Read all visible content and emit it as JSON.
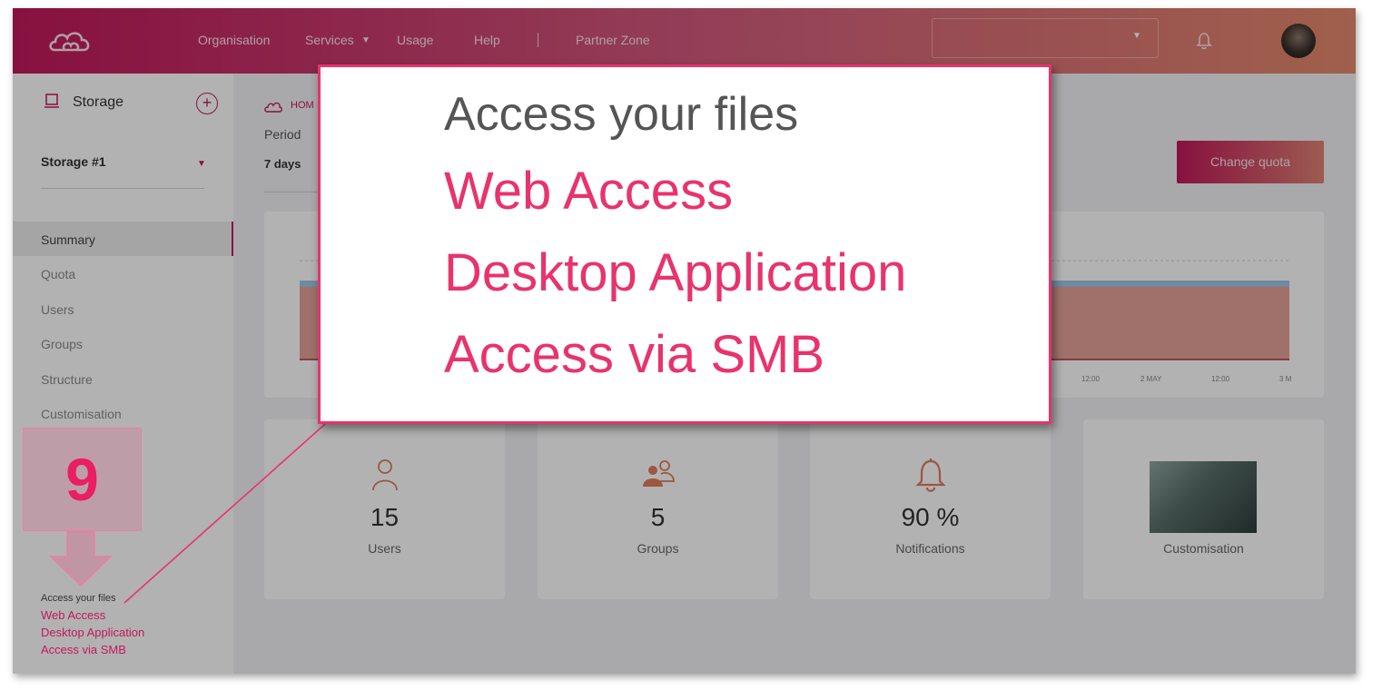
{
  "nav": {
    "items": [
      "Organisation",
      "Services",
      "Usage",
      "Help",
      "Partner Zone"
    ]
  },
  "sidebar": {
    "title": "Storage",
    "selected_storage": "Storage #1",
    "menu": [
      "Summary",
      "Quota",
      "Users",
      "Groups",
      "Structure",
      "Customisation"
    ],
    "active_item": "Summary",
    "access": {
      "title": "Access your files",
      "links": [
        "Web Access",
        "Desktop Application",
        "Access via SMB"
      ]
    }
  },
  "main": {
    "breadcrumb": "HOM",
    "period_label": "Period",
    "period_value": "7 days",
    "change_quota_label": "Change quota",
    "chart": {
      "x_ticks": [
        "12:00",
        "2 MAY",
        "12:00",
        "3 M"
      ]
    },
    "stats": [
      {
        "icon": "user-icon",
        "value": "15",
        "label": "Users"
      },
      {
        "icon": "group-icon",
        "value": "5",
        "label": "Groups"
      },
      {
        "icon": "bell-icon",
        "value": "90 %",
        "label": "Notifications"
      },
      {
        "icon": "image-thumbnail",
        "value": "",
        "label": "Customisation"
      }
    ]
  },
  "annotation": {
    "step_number": "9",
    "color": "#e8336d"
  },
  "zoom": {
    "title": "Access your files",
    "links": [
      "Web Access",
      "Desktop Application",
      "Access via SMB"
    ]
  }
}
